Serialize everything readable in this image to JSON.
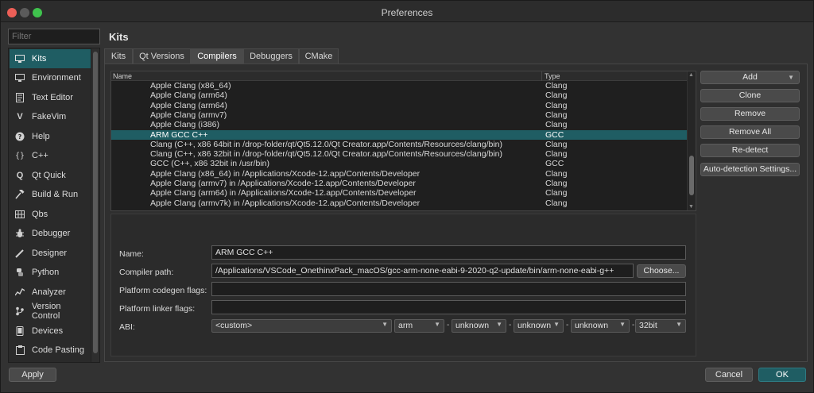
{
  "window": {
    "title": "Preferences"
  },
  "sidebar": {
    "filter_placeholder": "Filter",
    "items": [
      {
        "label": "Kits",
        "icon": "monitor-icon"
      },
      {
        "label": "Environment",
        "icon": "monitor-icon"
      },
      {
        "label": "Text Editor",
        "icon": "document-icon"
      },
      {
        "label": "FakeVim",
        "icon": "fakevim-icon"
      },
      {
        "label": "Help",
        "icon": "help-icon"
      },
      {
        "label": "C++",
        "icon": "braces-icon"
      },
      {
        "label": "Qt Quick",
        "icon": "qt-quick-icon"
      },
      {
        "label": "Build & Run",
        "icon": "hammer-icon"
      },
      {
        "label": "Qbs",
        "icon": "grid-icon"
      },
      {
        "label": "Debugger",
        "icon": "bug-icon"
      },
      {
        "label": "Designer",
        "icon": "pen-icon"
      },
      {
        "label": "Python",
        "icon": "python-icon"
      },
      {
        "label": "Analyzer",
        "icon": "analyzer-icon"
      },
      {
        "label": "Version Control",
        "icon": "version-control-icon"
      },
      {
        "label": "Devices",
        "icon": "device-icon"
      },
      {
        "label": "Code Pasting",
        "icon": "paste-icon"
      }
    ]
  },
  "page_title": "Kits",
  "tabs": [
    {
      "label": "Kits"
    },
    {
      "label": "Qt Versions"
    },
    {
      "label": "Compilers"
    },
    {
      "label": "Debuggers"
    },
    {
      "label": "CMake"
    }
  ],
  "compilers": {
    "columns": {
      "name": "Name",
      "type": "Type"
    },
    "rows": [
      {
        "name": "Apple Clang (x86_64)",
        "type": "Clang"
      },
      {
        "name": "Apple Clang (arm64)",
        "type": "Clang"
      },
      {
        "name": "Apple Clang (arm64)",
        "type": "Clang"
      },
      {
        "name": "Apple Clang (armv7)",
        "type": "Clang"
      },
      {
        "name": "Apple Clang (i386)",
        "type": "Clang"
      },
      {
        "name": "ARM GCC C++",
        "type": "GCC"
      },
      {
        "name": "Clang (C++, x86 64bit in /drop-folder/qt/Qt5.12.0/Qt Creator.app/Contents/Resources/clang/bin)",
        "type": "Clang"
      },
      {
        "name": "Clang (C++, x86 32bit in /drop-folder/qt/Qt5.12.0/Qt Creator.app/Contents/Resources/clang/bin)",
        "type": "Clang"
      },
      {
        "name": "GCC (C++, x86 32bit in /usr/bin)",
        "type": "GCC"
      },
      {
        "name": "Apple Clang (x86_64) in /Applications/Xcode-12.app/Contents/Developer",
        "type": "Clang"
      },
      {
        "name": "Apple Clang (armv7) in /Applications/Xcode-12.app/Contents/Developer",
        "type": "Clang"
      },
      {
        "name": "Apple Clang (arm64) in /Applications/Xcode-12.app/Contents/Developer",
        "type": "Clang"
      },
      {
        "name": "Apple Clang (armv7k) in /Applications/Xcode-12.app/Contents/Developer",
        "type": "Clang"
      }
    ]
  },
  "buttons": {
    "add": "Add",
    "clone": "Clone",
    "remove": "Remove",
    "remove_all": "Remove All",
    "redetect": "Re-detect",
    "auto_detection": "Auto-detection Settings...",
    "choose": "Choose...",
    "apply": "Apply",
    "cancel": "Cancel",
    "ok": "OK"
  },
  "details": {
    "name_label": "Name:",
    "name_value": "ARM GCC C++",
    "compiler_path_label": "Compiler path:",
    "compiler_path_value": "/Applications/VSCode_OnethinxPack_macOS/gcc-arm-none-eabi-9-2020-q2-update/bin/arm-none-eabi-g++",
    "codegen_label": "Platform codegen flags:",
    "codegen_value": "",
    "linker_label": "Platform linker flags:",
    "linker_value": "",
    "abi_label": "ABI:",
    "abi": {
      "preset": "<custom>",
      "arch": "arm",
      "os": "unknown",
      "flavor": "unknown",
      "format": "unknown",
      "width": "32bit",
      "separator": "-"
    }
  },
  "colors": {
    "accent": "#1f5d63",
    "background": "#323232"
  }
}
